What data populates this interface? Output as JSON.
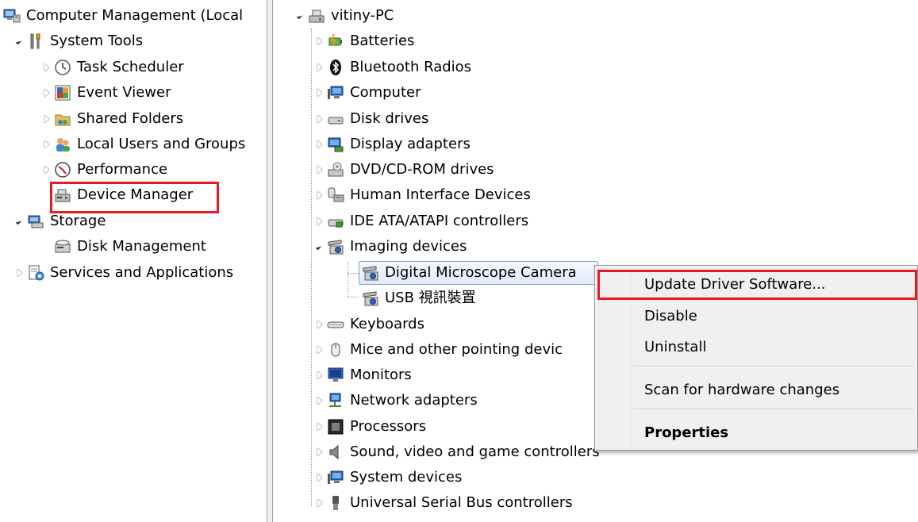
{
  "left_tree": {
    "root_label": "Computer Management (Local",
    "system_tools": "System Tools",
    "task_scheduler": "Task Scheduler",
    "event_viewer": "Event Viewer",
    "shared_folders": "Shared Folders",
    "local_users": "Local Users and Groups",
    "performance": "Performance",
    "device_manager": "Device Manager",
    "storage": "Storage",
    "disk_management": "Disk Management",
    "services_apps": "Services and Applications"
  },
  "device_tree": {
    "computer_name": "vitiny-PC",
    "items": [
      "Batteries",
      "Bluetooth Radios",
      "Computer",
      "Disk drives",
      "Display adapters",
      "DVD/CD-ROM drives",
      "Human Interface Devices",
      "IDE ATA/ATAPI controllers",
      "Imaging devices",
      "Digital Microscope Camera",
      "USB 視訊裝置",
      "Keyboards",
      "Mice and other pointing devic",
      "Monitors",
      "Network adapters",
      "Processors",
      "Sound, video and game controllers",
      "System devices",
      "Universal Serial Bus controllers"
    ]
  },
  "context_menu": {
    "update_driver": "Update Driver Software...",
    "disable": "Disable",
    "uninstall": "Uninstall",
    "scan": "Scan for hardware changes",
    "properties": "Properties"
  },
  "colors": {
    "highlight_border": "#e31b23",
    "selection_border": "#7da2ce",
    "menu_bg": "#f0f0f0"
  }
}
